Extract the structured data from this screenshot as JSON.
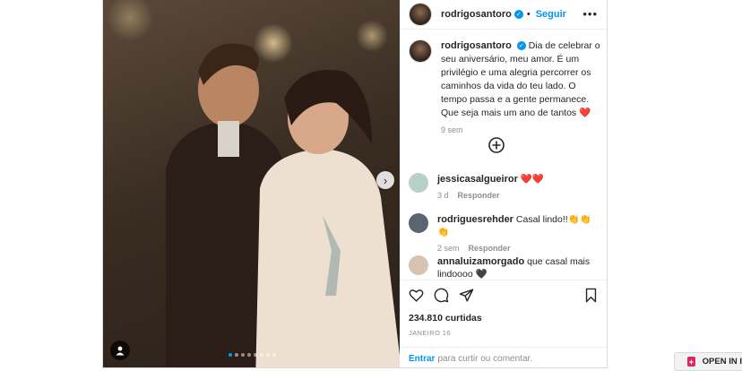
{
  "post": {
    "username": "rodrigosantoro",
    "follow_label": "Seguir",
    "more_glyph": "•••",
    "caption": "Dia de celebrar o seu aniversário, meu amor. É um privilégio e uma alegria percorrer os caminhos da vida do teu lado. O tempo passa e a gente permanece. Que seja mais um ano de tantos ❤️",
    "caption_time": "9 sem",
    "carousel": {
      "slide_count": 8,
      "active_index": 0
    }
  },
  "comments": [
    {
      "username": "jessicasalgueiror",
      "text": "❤️❤️",
      "time": "3 d",
      "reply_label": "Responder",
      "avatar_color": "#b9d0c6"
    },
    {
      "username": "rodriguesrehder",
      "text": "Casal lindo!!👏👏👏",
      "time": "2 sem",
      "reply_label": "Responder",
      "avatar_color": "#5b6470"
    },
    {
      "username": "annaluizamorgado",
      "text": "que casal mais lindoooo 🖤",
      "time": "",
      "reply_label": "",
      "avatar_color": "#d8c3b2"
    }
  ],
  "actions": {
    "likes": "234.810 curtidas",
    "date": "JANEIRO 16",
    "login_link": "Entrar",
    "login_text": "para curtir ou comentar."
  },
  "open_in": {
    "label": "OPEN IN I",
    "badge": "+"
  },
  "colors": {
    "accent": "#0095f6",
    "heart": "#e0245e"
  },
  "icons": [
    "verified-badge-icon",
    "more-options-icon",
    "add-comment-plus-icon",
    "heart-icon",
    "comment-icon",
    "share-icon",
    "bookmark-icon",
    "tag-user-icon",
    "chevron-right-icon"
  ]
}
